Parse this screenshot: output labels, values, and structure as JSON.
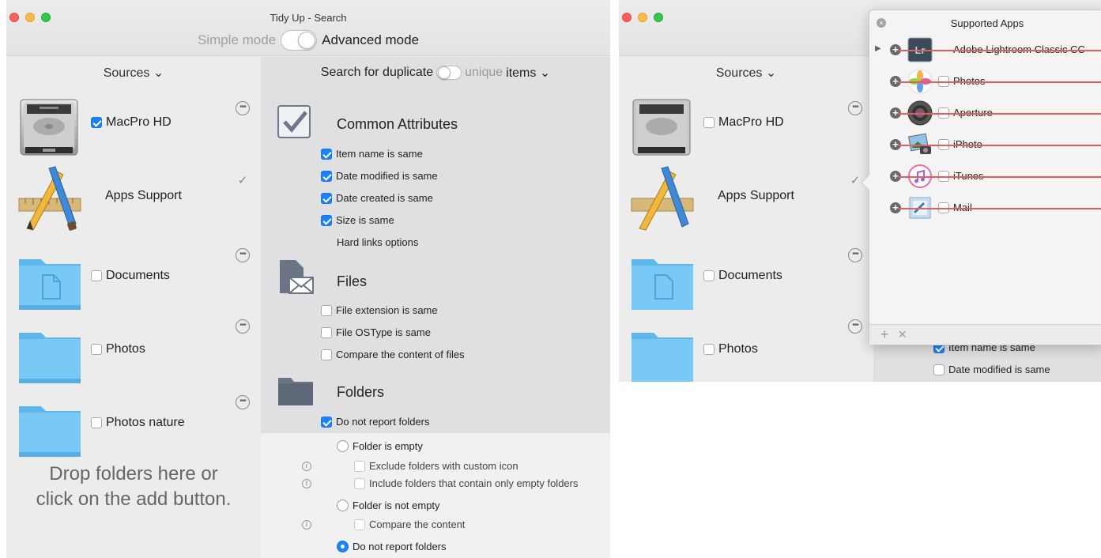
{
  "window1": {
    "title": "Tidy Up - Search",
    "mode_simple": "Simple mode",
    "mode_advanced": "Advanced mode",
    "sources_header": "Sources ⌄",
    "sources": [
      {
        "label": "MacPro HD",
        "checked": true,
        "icon": "hard-drive-icon"
      },
      {
        "label": "Apps Support",
        "checked": false,
        "icon": "app-tools-icon"
      },
      {
        "label": "Documents",
        "checked": false,
        "icon": "documents-folder-icon"
      },
      {
        "label": "Photos",
        "checked": false,
        "icon": "folder-icon"
      },
      {
        "label": "Photos nature",
        "checked": false,
        "icon": "folder-icon"
      }
    ],
    "drop_text_1": "Drop folders here or",
    "drop_text_2": "click on the add button.",
    "search_for": "Search for duplicate",
    "search_unique": "unique",
    "search_items": "items ⌄",
    "common_title": "Common Attributes",
    "common_items": [
      {
        "label": "Item name is same",
        "checked": true
      },
      {
        "label": "Date modified is same",
        "checked": true
      },
      {
        "label": "Date created is same",
        "checked": true
      },
      {
        "label": "Size is same",
        "checked": true
      }
    ],
    "hard_links": "Hard links options",
    "files_title": "Files",
    "files_items": [
      {
        "label": "File extension is same",
        "checked": false
      },
      {
        "label": "File OSType is same",
        "checked": false
      },
      {
        "label": "Compare the content of files",
        "checked": false
      }
    ],
    "folders_title": "Folders",
    "folders_do_not_report": "Do not report folders",
    "folder_is_empty": "Folder is empty",
    "exclude_custom_icon": "Exclude folders with custom icon",
    "include_only_empty": "Include folders that contain only empty folders",
    "folder_not_empty": "Folder is not empty",
    "compare_content": "Compare the content",
    "do_not_report_radio": "Do not report folders"
  },
  "window2": {
    "sources_header": "Sources ⌄",
    "sources": [
      {
        "label": "MacPro HD"
      },
      {
        "label": "Apps Support"
      },
      {
        "label": "Documents"
      },
      {
        "label": "Photos"
      }
    ],
    "popover_title": "Supported Apps",
    "apps": [
      {
        "name": "Adobe Lightroom Classic CC",
        "icon": "lightroom-icon",
        "has_disclosure": true
      },
      {
        "name": "Photos",
        "icon": "photos-icon"
      },
      {
        "name": "Aperture",
        "icon": "aperture-icon"
      },
      {
        "name": "iPhoto",
        "icon": "iphoto-icon"
      },
      {
        "name": "iTunes",
        "icon": "itunes-icon"
      },
      {
        "name": "Mail",
        "icon": "mail-icon"
      }
    ],
    "add_label": "+",
    "remove_label": "×",
    "crit_item_1": "Item name is same",
    "crit_item_2": "Date modified is same"
  },
  "colors": {
    "accent": "#1a82fb",
    "strike": "#e06060",
    "folder": "#6cc0f0"
  }
}
